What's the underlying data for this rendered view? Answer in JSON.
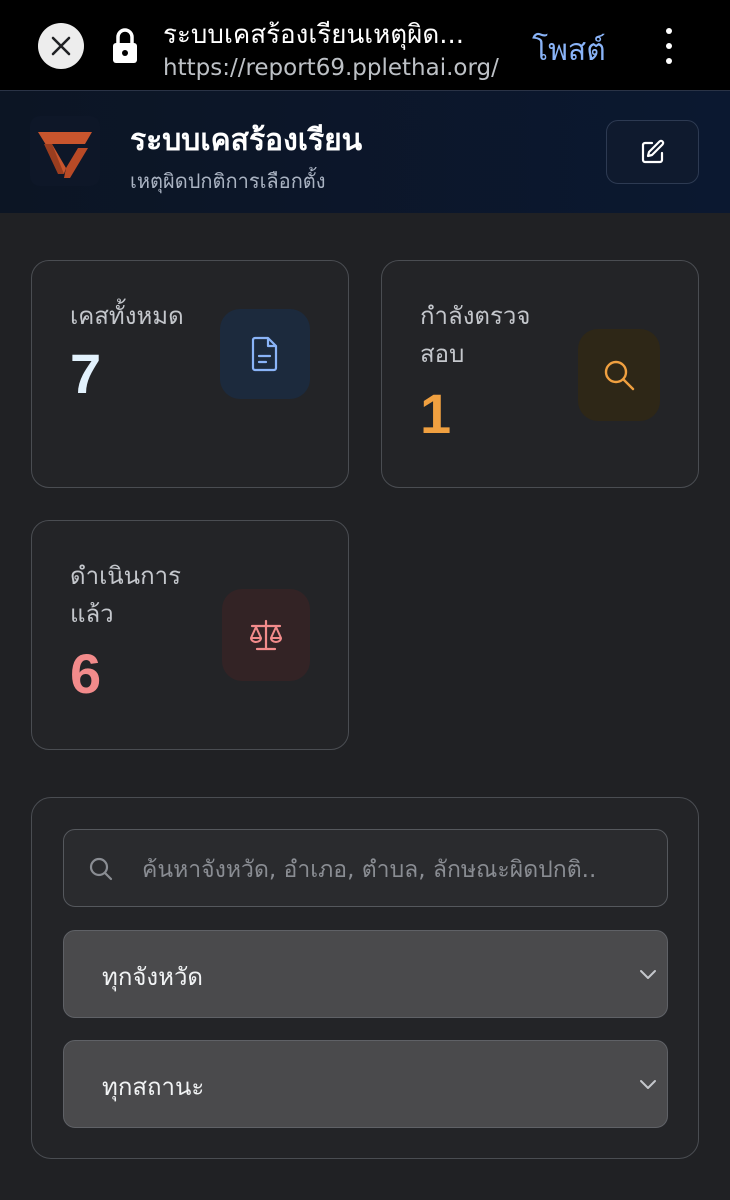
{
  "browser": {
    "page_title": "ระบบเคสร้องเรียนเหตุผิด...",
    "url": "https://report69.pplethai.org/",
    "post_label": "โพสต์"
  },
  "header": {
    "title": "ระบบเคสร้องเรียน",
    "subtitle": "เหตุผิดปกติการเลือกตั้ง"
  },
  "stats": {
    "total": {
      "label": "เคสทั้งหมด",
      "value": "7",
      "color": "#e3f2fd"
    },
    "investigating": {
      "label_line1": "กำลังตรวจ",
      "label_line2": "สอบ",
      "value": "1",
      "color": "#f0a040"
    },
    "done": {
      "label_line1": "ดำเนินการ",
      "label_line2": "แล้ว",
      "value": "6",
      "color": "#f28b8b"
    }
  },
  "filters": {
    "search_placeholder": "ค้นหาจังหวัด, อำเภอ, ตำบล, ลักษณะผิดปกติ..",
    "province_selected": "ทุกจังหวัด",
    "status_selected": "ทุกสถานะ"
  },
  "colors": {
    "accent_orange": "#c8552d",
    "link_blue": "#8ab4f8"
  }
}
